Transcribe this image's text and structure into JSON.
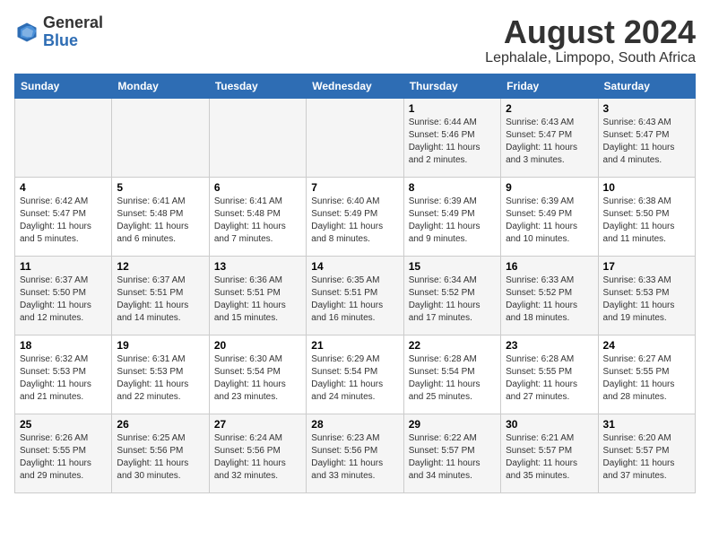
{
  "logo": {
    "general": "General",
    "blue": "Blue"
  },
  "title": "August 2024",
  "subtitle": "Lephalale, Limpopo, South Africa",
  "days_of_week": [
    "Sunday",
    "Monday",
    "Tuesday",
    "Wednesday",
    "Thursday",
    "Friday",
    "Saturday"
  ],
  "weeks": [
    [
      {
        "day": "",
        "info": ""
      },
      {
        "day": "",
        "info": ""
      },
      {
        "day": "",
        "info": ""
      },
      {
        "day": "",
        "info": ""
      },
      {
        "day": "1",
        "info": "Sunrise: 6:44 AM\nSunset: 5:46 PM\nDaylight: 11 hours\nand 2 minutes."
      },
      {
        "day": "2",
        "info": "Sunrise: 6:43 AM\nSunset: 5:47 PM\nDaylight: 11 hours\nand 3 minutes."
      },
      {
        "day": "3",
        "info": "Sunrise: 6:43 AM\nSunset: 5:47 PM\nDaylight: 11 hours\nand 4 minutes."
      }
    ],
    [
      {
        "day": "4",
        "info": "Sunrise: 6:42 AM\nSunset: 5:47 PM\nDaylight: 11 hours\nand 5 minutes."
      },
      {
        "day": "5",
        "info": "Sunrise: 6:41 AM\nSunset: 5:48 PM\nDaylight: 11 hours\nand 6 minutes."
      },
      {
        "day": "6",
        "info": "Sunrise: 6:41 AM\nSunset: 5:48 PM\nDaylight: 11 hours\nand 7 minutes."
      },
      {
        "day": "7",
        "info": "Sunrise: 6:40 AM\nSunset: 5:49 PM\nDaylight: 11 hours\nand 8 minutes."
      },
      {
        "day": "8",
        "info": "Sunrise: 6:39 AM\nSunset: 5:49 PM\nDaylight: 11 hours\nand 9 minutes."
      },
      {
        "day": "9",
        "info": "Sunrise: 6:39 AM\nSunset: 5:49 PM\nDaylight: 11 hours\nand 10 minutes."
      },
      {
        "day": "10",
        "info": "Sunrise: 6:38 AM\nSunset: 5:50 PM\nDaylight: 11 hours\nand 11 minutes."
      }
    ],
    [
      {
        "day": "11",
        "info": "Sunrise: 6:37 AM\nSunset: 5:50 PM\nDaylight: 11 hours\nand 12 minutes."
      },
      {
        "day": "12",
        "info": "Sunrise: 6:37 AM\nSunset: 5:51 PM\nDaylight: 11 hours\nand 14 minutes."
      },
      {
        "day": "13",
        "info": "Sunrise: 6:36 AM\nSunset: 5:51 PM\nDaylight: 11 hours\nand 15 minutes."
      },
      {
        "day": "14",
        "info": "Sunrise: 6:35 AM\nSunset: 5:51 PM\nDaylight: 11 hours\nand 16 minutes."
      },
      {
        "day": "15",
        "info": "Sunrise: 6:34 AM\nSunset: 5:52 PM\nDaylight: 11 hours\nand 17 minutes."
      },
      {
        "day": "16",
        "info": "Sunrise: 6:33 AM\nSunset: 5:52 PM\nDaylight: 11 hours\nand 18 minutes."
      },
      {
        "day": "17",
        "info": "Sunrise: 6:33 AM\nSunset: 5:53 PM\nDaylight: 11 hours\nand 19 minutes."
      }
    ],
    [
      {
        "day": "18",
        "info": "Sunrise: 6:32 AM\nSunset: 5:53 PM\nDaylight: 11 hours\nand 21 minutes."
      },
      {
        "day": "19",
        "info": "Sunrise: 6:31 AM\nSunset: 5:53 PM\nDaylight: 11 hours\nand 22 minutes."
      },
      {
        "day": "20",
        "info": "Sunrise: 6:30 AM\nSunset: 5:54 PM\nDaylight: 11 hours\nand 23 minutes."
      },
      {
        "day": "21",
        "info": "Sunrise: 6:29 AM\nSunset: 5:54 PM\nDaylight: 11 hours\nand 24 minutes."
      },
      {
        "day": "22",
        "info": "Sunrise: 6:28 AM\nSunset: 5:54 PM\nDaylight: 11 hours\nand 25 minutes."
      },
      {
        "day": "23",
        "info": "Sunrise: 6:28 AM\nSunset: 5:55 PM\nDaylight: 11 hours\nand 27 minutes."
      },
      {
        "day": "24",
        "info": "Sunrise: 6:27 AM\nSunset: 5:55 PM\nDaylight: 11 hours\nand 28 minutes."
      }
    ],
    [
      {
        "day": "25",
        "info": "Sunrise: 6:26 AM\nSunset: 5:55 PM\nDaylight: 11 hours\nand 29 minutes."
      },
      {
        "day": "26",
        "info": "Sunrise: 6:25 AM\nSunset: 5:56 PM\nDaylight: 11 hours\nand 30 minutes."
      },
      {
        "day": "27",
        "info": "Sunrise: 6:24 AM\nSunset: 5:56 PM\nDaylight: 11 hours\nand 32 minutes."
      },
      {
        "day": "28",
        "info": "Sunrise: 6:23 AM\nSunset: 5:56 PM\nDaylight: 11 hours\nand 33 minutes."
      },
      {
        "day": "29",
        "info": "Sunrise: 6:22 AM\nSunset: 5:57 PM\nDaylight: 11 hours\nand 34 minutes."
      },
      {
        "day": "30",
        "info": "Sunrise: 6:21 AM\nSunset: 5:57 PM\nDaylight: 11 hours\nand 35 minutes."
      },
      {
        "day": "31",
        "info": "Sunrise: 6:20 AM\nSunset: 5:57 PM\nDaylight: 11 hours\nand 37 minutes."
      }
    ]
  ],
  "accent_color": "#2e6db4"
}
